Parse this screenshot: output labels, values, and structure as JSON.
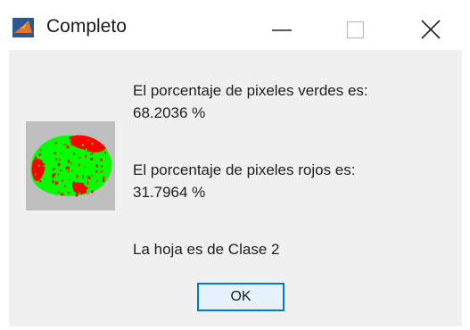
{
  "window": {
    "title": "Completo",
    "icon": "matlab-icon",
    "controls": [
      "minimize-icon",
      "maximize-icon",
      "close-icon"
    ]
  },
  "dialog": {
    "green_label": "El porcentaje de pixeles verdes es:",
    "green_value": "68.2036 %",
    "red_label": "El porcentaje de pixeles rojos es:",
    "red_value": "31.7964 %",
    "class_text": "La hoja es de Clase 2",
    "ok_label": "OK"
  },
  "colors": {
    "green": "#00ff00",
    "red": "#ff0000",
    "background": "#f0f0f0",
    "button_border": "#0078d7"
  }
}
